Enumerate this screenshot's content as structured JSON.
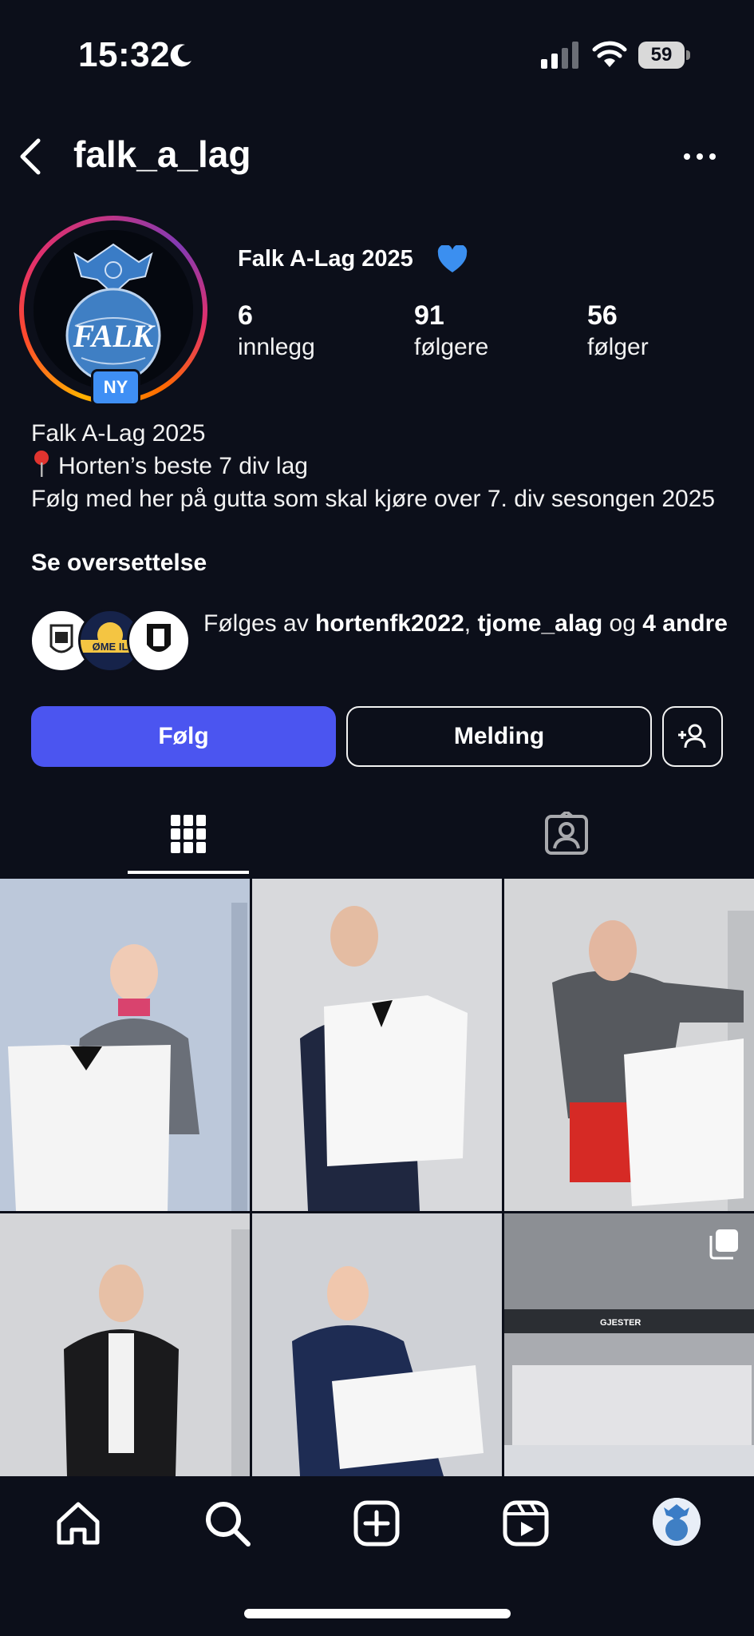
{
  "status_bar": {
    "time": "15:32",
    "battery": "59"
  },
  "header": {
    "username": "falk_a_lag"
  },
  "profile": {
    "avatar_badge": "NY",
    "avatar_text": "FALK",
    "display_name": "Falk A-Lag 2025",
    "stats": [
      {
        "value": "6",
        "label": "innlegg"
      },
      {
        "value": "91",
        "label": "følgere"
      },
      {
        "value": "56",
        "label": "følger"
      }
    ],
    "bio_line1": "Falk A-Lag 2025",
    "bio_line2": "Horten’s beste 7 div lag",
    "bio_line3": "Følg med her på gutta som skal kjøre over 7. div sesongen 2025",
    "see_translation": "Se oversettelse",
    "followed_by_prefix": "Følges av ",
    "followed_by_user1": "hortenfk2022",
    "followed_by_sep": ", ",
    "followed_by_user2": "tjome_alag",
    "followed_by_mid": " og ",
    "followed_by_others": "4 andre",
    "follower_avatar2_text": "ØME IL"
  },
  "buttons": {
    "follow": "Følg",
    "message": "Melding"
  },
  "grid": {
    "posts": [
      {
        "kind": "photo",
        "bg": "#bcc8da"
      },
      {
        "kind": "photo",
        "bg": "#d8d9dc"
      },
      {
        "kind": "photo",
        "bg": "#d5d6d8"
      },
      {
        "kind": "photo",
        "bg": "#d4d5d8"
      },
      {
        "kind": "photo",
        "bg": "#cfd1d6"
      },
      {
        "kind": "carousel",
        "bg": "#6a6e75"
      }
    ],
    "post6_sign": "GJESTER"
  },
  "colors": {
    "background": "#0c0f1a",
    "accent": "#4b55f0",
    "badge": "#3f8ff5"
  }
}
